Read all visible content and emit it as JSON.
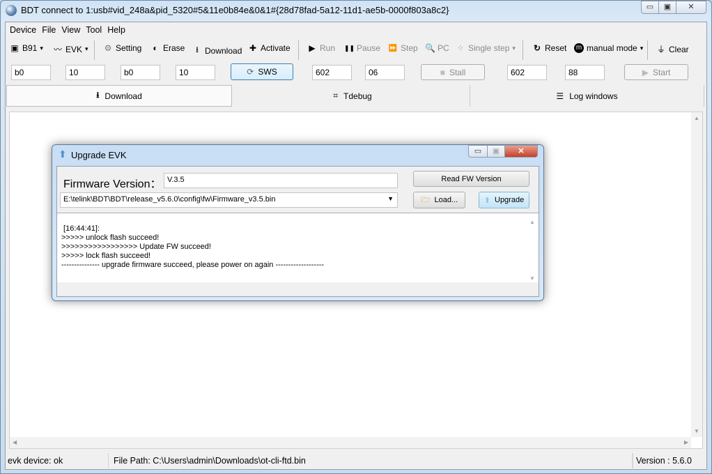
{
  "window": {
    "title": "BDT connect to 1:usb#vid_248a&pid_5320#5&11e0b84e&0&1#{28d78fad-5a12-11d1-ae5b-0000f803a8c2}",
    "minimize": "▭",
    "maximize": "▣",
    "close": "✕"
  },
  "menu": [
    "Device",
    "File",
    "View",
    "Tool",
    "Help"
  ],
  "toolbar": {
    "chip": {
      "icon": "chip-icon",
      "glyph": "▣",
      "label": "B91"
    },
    "evk": {
      "icon": "signal-icon",
      "glyph": "〰",
      "label": "EVK"
    },
    "setting": {
      "icon": "gear-icon",
      "glyph": "⚙",
      "label": "Setting"
    },
    "erase": {
      "icon": "eraser-icon",
      "glyph": "◐",
      "label": "Erase"
    },
    "download": {
      "icon": "download-icon",
      "glyph": "⭳",
      "label": "Download"
    },
    "activate": {
      "icon": "plus-icon",
      "glyph": "✚",
      "label": "Activate"
    },
    "run": {
      "icon": "run-icon",
      "glyph": "▶",
      "label": "Run"
    },
    "pause": {
      "icon": "pause-icon",
      "glyph": "❚❚",
      "label": "Pause"
    },
    "step": {
      "icon": "step-icon",
      "glyph": "⏩",
      "label": "Step"
    },
    "pc": {
      "icon": "search-icon",
      "glyph": "🔍",
      "label": "PC"
    },
    "single_step": {
      "icon": "footsteps-icon",
      "glyph": "⁘",
      "label": "Single step"
    },
    "reset": {
      "icon": "reset-icon",
      "glyph": "↻",
      "label": "Reset"
    },
    "mode": {
      "icon": "mode-icon",
      "glyph": "m",
      "label": "manual mode"
    },
    "clear": {
      "icon": "broom-icon",
      "glyph": "⏚",
      "label": "Clear"
    },
    "dropdown": "▾"
  },
  "fields": {
    "f1": "b0",
    "f2": "10",
    "f3": "b0",
    "f4": "10",
    "sws": "SWS",
    "f5": "602",
    "f6": "06",
    "stall": "Stall",
    "f7": "602",
    "f8": "88",
    "start": "Start"
  },
  "tabs": [
    {
      "label": "Download",
      "icon": "download-icon",
      "glyph": "⭳"
    },
    {
      "label": "Tdebug",
      "icon": "binary-icon",
      "glyph": "⌗"
    },
    {
      "label": "Log windows",
      "icon": "list-icon",
      "glyph": "☰"
    }
  ],
  "dialog": {
    "title": "Upgrade EVK",
    "fw_label": "Firmware Version：",
    "fw_value": "V.3.5",
    "read_button": "Read FW Version",
    "path": "E:\\telink\\BDT\\BDT\\release_v5.6.0\\config\\fw\\Firmware_v3.5.bin",
    "load_button": "Load...",
    "upgrade_button": "Upgrade",
    "log": [
      " [16:44:41]:",
      ">>>>> unlock flash succeed!",
      ">>>>>>>>>>>>>>>>> Update FW succeed!",
      ">>>>> lock flash succeed!",
      "--------------- upgrade firmware succeed, please power on again -------------------"
    ]
  },
  "status": {
    "device": "evk device: ok",
    "file_path": "File Path:  C:\\Users\\admin\\Downloads\\ot-cli-ftd.bin",
    "version": "Version : 5.6.0"
  },
  "colors": {
    "accent": "#3c7fb1",
    "disabled": "#8a8a8a"
  }
}
